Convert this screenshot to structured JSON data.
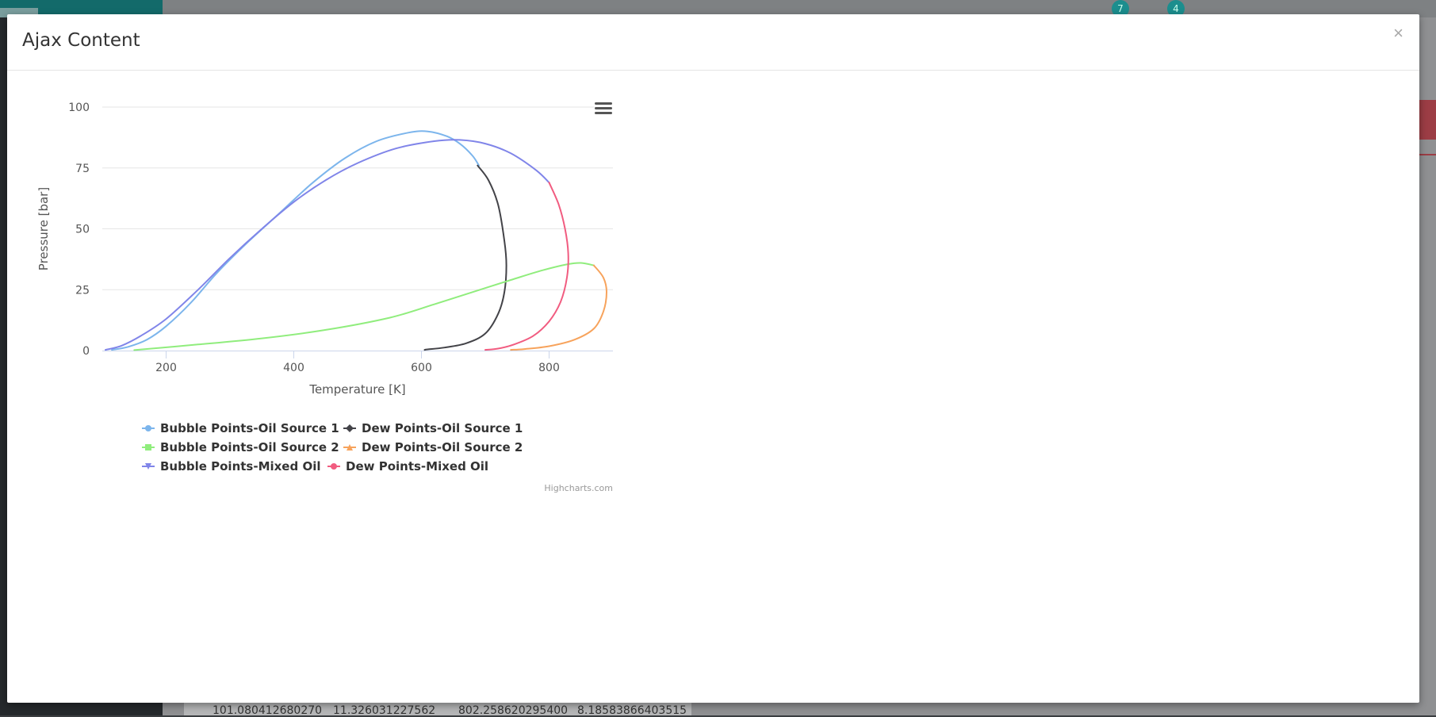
{
  "modal": {
    "title": "Ajax Content",
    "close_label": "×"
  },
  "background": {
    "badges": [
      "7",
      "4"
    ],
    "table_row": [
      "101.080412680270",
      "11.326031227562",
      "802.258620295400",
      "8.18583866403515"
    ]
  },
  "chart_menu_icon": "hamburger-menu-icon",
  "credits": "Highcharts.com",
  "chart_data": {
    "type": "line",
    "xlabel": "Temperature [K]",
    "ylabel": "Pressure [bar]",
    "xlim": [
      100,
      900
    ],
    "ylim": [
      0,
      100
    ],
    "x_ticks": [
      200,
      400,
      600,
      800
    ],
    "y_ticks": [
      0,
      25,
      50,
      75,
      100
    ],
    "grid": true,
    "legend_position": "bottom",
    "series": [
      {
        "name": "Bubble Points-Oil Source 1",
        "color": "#7cb5ec",
        "marker": "circle",
        "points": [
          [
            115,
            0.3
          ],
          [
            140,
            1.5
          ],
          [
            170,
            4.5
          ],
          [
            200,
            10
          ],
          [
            240,
            20
          ],
          [
            280,
            32
          ],
          [
            330,
            45
          ],
          [
            380,
            57
          ],
          [
            430,
            69
          ],
          [
            480,
            79
          ],
          [
            530,
            86
          ],
          [
            580,
            89.5
          ],
          [
            610,
            90
          ],
          [
            640,
            88
          ],
          [
            660,
            85
          ],
          [
            680,
            80
          ],
          [
            690,
            76
          ]
        ]
      },
      {
        "name": "Dew Points-Oil Source 1",
        "color": "#434348",
        "marker": "diamond",
        "points": [
          [
            688,
            76
          ],
          [
            705,
            70
          ],
          [
            720,
            60
          ],
          [
            730,
            45
          ],
          [
            733,
            35
          ],
          [
            730,
            24
          ],
          [
            720,
            15
          ],
          [
            700,
            7
          ],
          [
            670,
            3
          ],
          [
            635,
            1.2
          ],
          [
            610,
            0.5
          ],
          [
            605,
            0.3
          ]
        ]
      },
      {
        "name": "Bubble Points-Oil Source 2",
        "color": "#90ed7d",
        "marker": "square",
        "points": [
          [
            150,
            0.2
          ],
          [
            250,
            2.5
          ],
          [
            350,
            5
          ],
          [
            450,
            8.5
          ],
          [
            550,
            13.5
          ],
          [
            620,
            19
          ],
          [
            680,
            24
          ],
          [
            740,
            29
          ],
          [
            790,
            33
          ],
          [
            830,
            35.5
          ],
          [
            850,
            36
          ],
          [
            870,
            35
          ]
        ]
      },
      {
        "name": "Dew Points-Oil Source 2",
        "color": "#f7a35c",
        "marker": "triangle",
        "points": [
          [
            870,
            35
          ],
          [
            885,
            30
          ],
          [
            890,
            24
          ],
          [
            885,
            16
          ],
          [
            870,
            9
          ],
          [
            840,
            4.5
          ],
          [
            800,
            1.8
          ],
          [
            760,
            0.6
          ],
          [
            740,
            0.3
          ]
        ]
      },
      {
        "name": "Bubble Points-Mixed Oil",
        "color": "#8085e9",
        "marker": "triangle-down",
        "points": [
          [
            105,
            0.3
          ],
          [
            130,
            2
          ],
          [
            160,
            6
          ],
          [
            200,
            13
          ],
          [
            250,
            25
          ],
          [
            300,
            38
          ],
          [
            350,
            50
          ],
          [
            400,
            61
          ],
          [
            450,
            70
          ],
          [
            500,
            77
          ],
          [
            560,
            83
          ],
          [
            620,
            86
          ],
          [
            660,
            86.5
          ],
          [
            700,
            85
          ],
          [
            740,
            81
          ],
          [
            780,
            74
          ],
          [
            800,
            69
          ]
        ]
      },
      {
        "name": "Dew Points-Mixed Oil",
        "color": "#f15c80",
        "marker": "circle",
        "points": [
          [
            800,
            69
          ],
          [
            815,
            60
          ],
          [
            825,
            50
          ],
          [
            830,
            40
          ],
          [
            828,
            30
          ],
          [
            818,
            20
          ],
          [
            800,
            12
          ],
          [
            775,
            6
          ],
          [
            745,
            2.5
          ],
          [
            720,
            0.8
          ],
          [
            700,
            0.3
          ]
        ]
      }
    ]
  }
}
